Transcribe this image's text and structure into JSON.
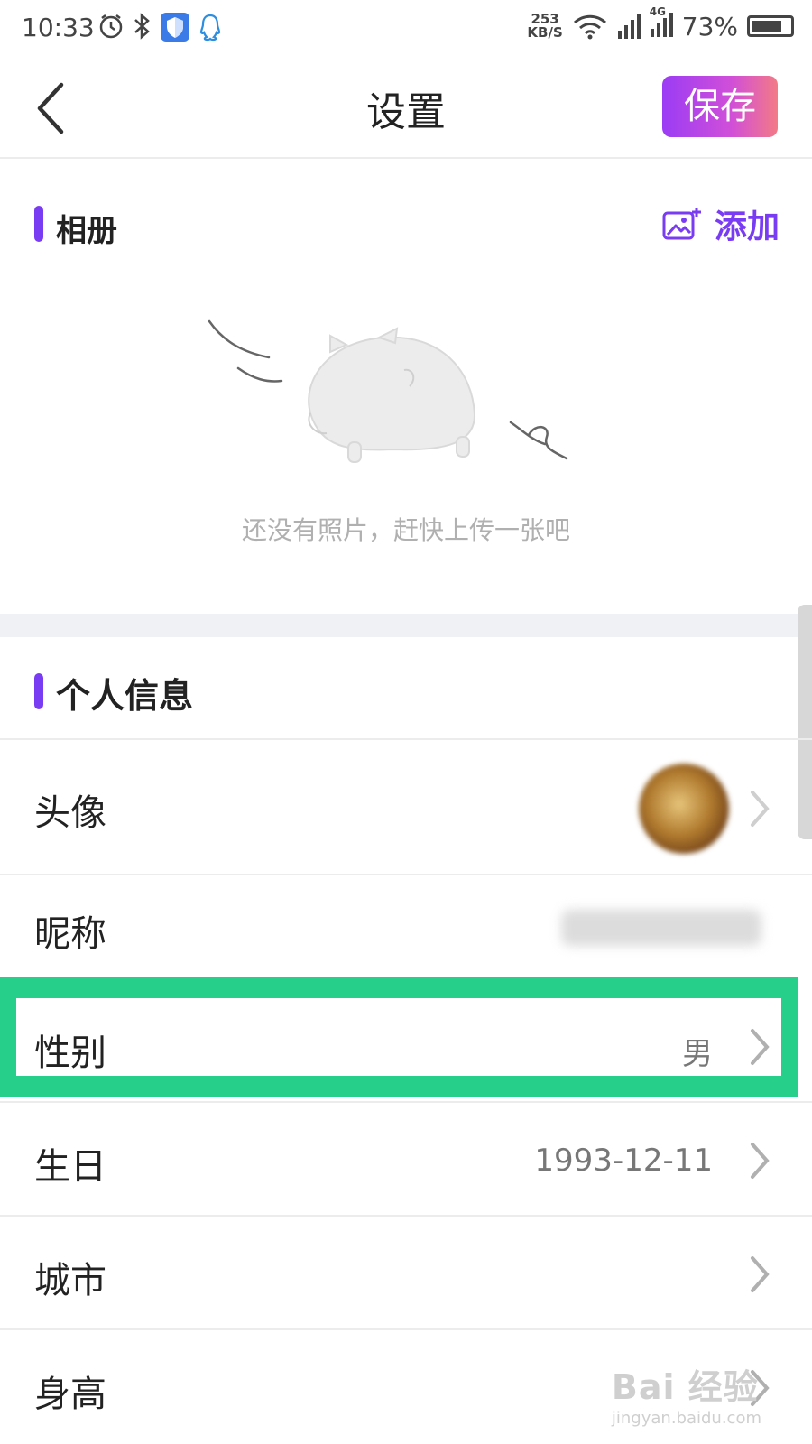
{
  "status_bar": {
    "time": "10:33",
    "speed_value": "253",
    "speed_unit": "KB/S",
    "network_label": "4G",
    "battery": "73%"
  },
  "header": {
    "title": "设置",
    "save_label": "保存"
  },
  "album": {
    "title": "相册",
    "add_label": "添加",
    "empty_text": "还没有照片，赶快上传一张吧"
  },
  "profile": {
    "title": "个人信息",
    "rows": [
      {
        "label": "头像",
        "value": ""
      },
      {
        "label": "昵称",
        "value": ""
      },
      {
        "label": "性别",
        "value": "男"
      },
      {
        "label": "生日",
        "value": "1993-12-11"
      },
      {
        "label": "城市",
        "value": ""
      },
      {
        "label": "身高",
        "value": ""
      }
    ]
  },
  "colors": {
    "accent": "#7a3cf3",
    "save_gradient_start": "#9b3cf5",
    "save_gradient_end": "#f37a86",
    "highlight": "#26d08a"
  },
  "watermark": {
    "main": "Bai 经验",
    "sub": "jingyan.baidu.com"
  }
}
